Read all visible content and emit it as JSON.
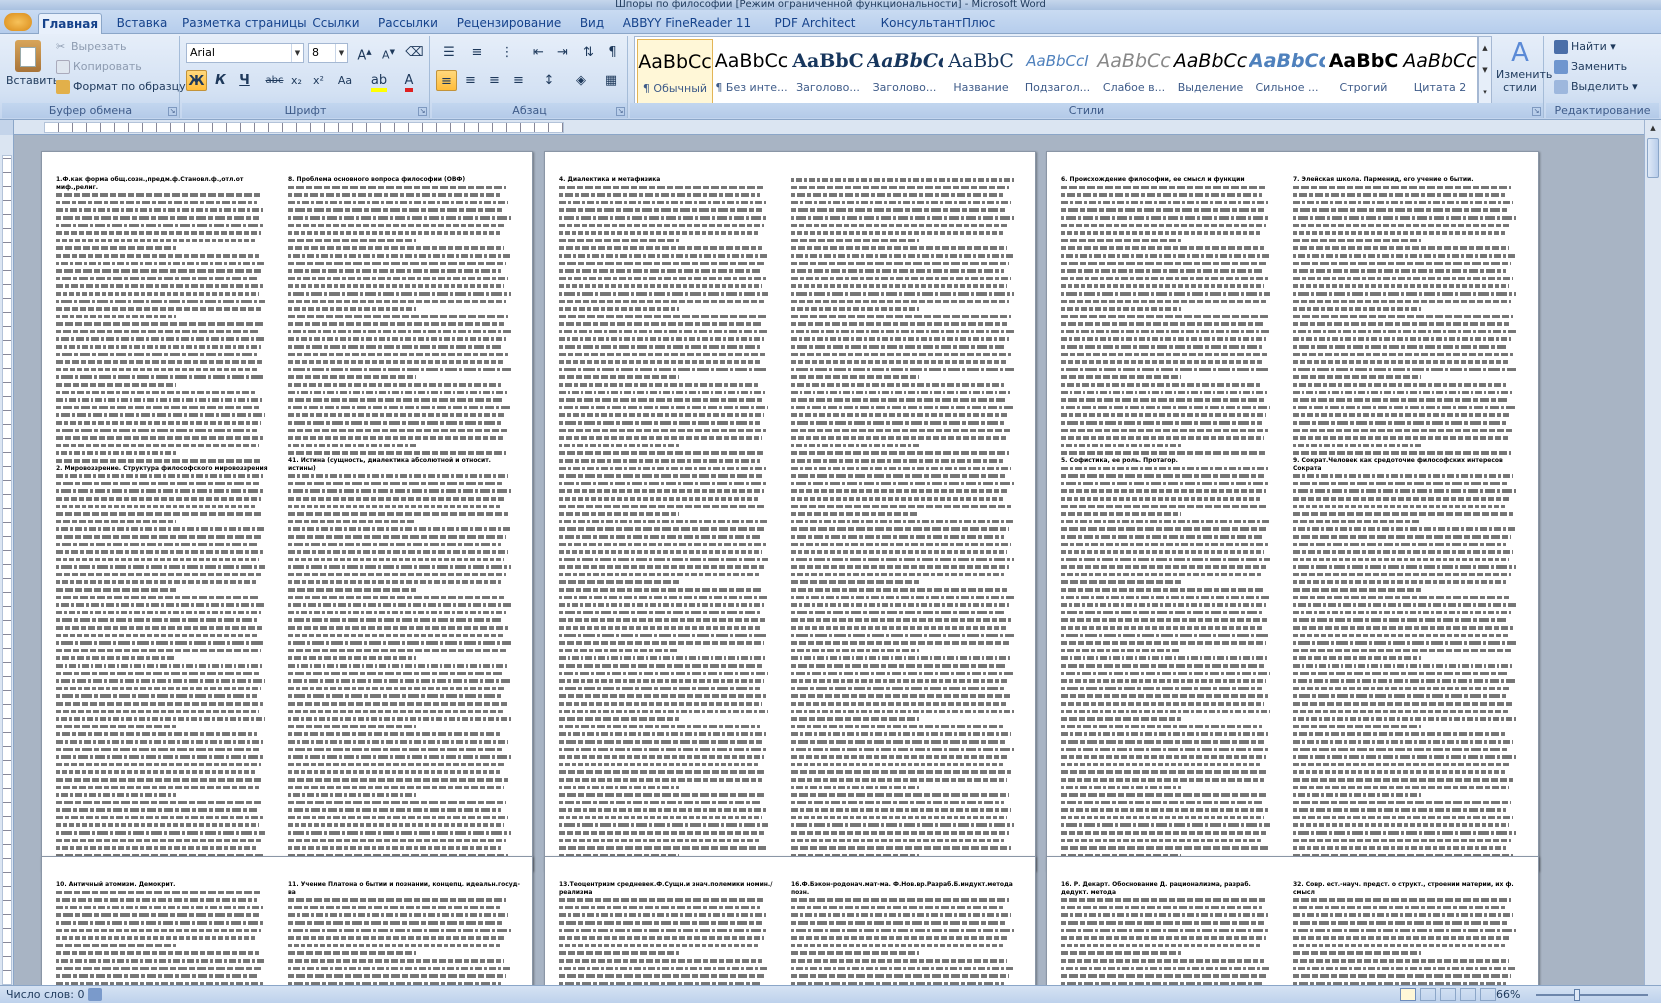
{
  "title": "Шпоры по философии [Режим ограниченной функциональности] - Microsoft Word",
  "tabs": [
    "Главная",
    "Вставка",
    "Разметка страницы",
    "Ссылки",
    "Рассылки",
    "Рецензирование",
    "Вид",
    "ABBYY FineReader 11",
    "PDF Architect",
    "КонсультантПлюс"
  ],
  "clipboard": {
    "paste": "Вставить",
    "cut": "Вырезать",
    "copy": "Копировать",
    "format_painter": "Формат по образцу",
    "label": "Буфер обмена"
  },
  "font": {
    "name": "Arial",
    "size": "8",
    "label": "Шрифт",
    "bold": "Ж",
    "italic": "К",
    "underline": "Ч",
    "strike": "abc",
    "sub": "x₂",
    "sup": "x²",
    "case": "Aa"
  },
  "paragraph": {
    "label": "Абзац"
  },
  "styles": {
    "label": "Стили",
    "items": [
      {
        "preview": "AaBbCc",
        "name": "¶ Обычный"
      },
      {
        "preview": "AaBbCc",
        "name": "¶ Без инте..."
      },
      {
        "preview": "AaBbC",
        "name": "Заголово..."
      },
      {
        "preview": "AaBbCc",
        "name": "Заголово..."
      },
      {
        "preview": "AaBbC",
        "name": "Название"
      },
      {
        "preview": "AaBbCcI",
        "name": "Подзагол..."
      },
      {
        "preview": "AaBbCc",
        "name": "Слабое в..."
      },
      {
        "preview": "AaBbCc",
        "name": "Выделение"
      },
      {
        "preview": "AaBbCc",
        "name": "Сильное ..."
      },
      {
        "preview": "AaBbC",
        "name": "Строгий"
      },
      {
        "preview": "AaBbCc",
        "name": "Цитата 2"
      }
    ],
    "change": "Изменить стили"
  },
  "editing": {
    "label": "Редактирование",
    "find": "Найти",
    "replace": "Заменить",
    "select": "Выделить"
  },
  "pages": [
    {
      "headings": [
        "1.Ф.как форма общ.созн.,предм.ф.Становл.ф.,отл.от миф.,религ.",
        "8. Проблема основного вопроса философии (ОВФ)",
        "2. Мировоззрение. Структура философского мировоззрения",
        "41. Истина (сущность, диалектика абсолютной и относит. истины)"
      ]
    },
    {
      "headings": [
        "4. Диалектика и метафизика",
        ""
      ]
    },
    {
      "headings": [
        "6. Происхождение философии, ее смысл и функции",
        "7. Элейская школа. Парменид, его учение о бытии.",
        "5. Софистика, ее роль. Протагор.",
        "9. Сократ.Человек как средоточие философских интересов Сократа"
      ]
    },
    {
      "headings": [
        "10. Античный атомизм. Демокрит.",
        "11. Учение Платона о бытии и познании, концепц. идеальн.госуд-ва"
      ]
    },
    {
      "headings": [
        "13.Теоцентризм средневек.Ф.Сущн.и знач.полемики номин./реализма",
        "16.Ф.Бэкон-родонач.мат-ма. Ф.Нов.вр.Разраб.Б.индукт.метода позн."
      ]
    },
    {
      "headings": [
        "16. Р. Декарт. Обоснование Д. рационализма, разраб. дедукт. метода",
        "32. Совр. ест.-науч. предст. о структ., строении материи, их ф. смысл"
      ]
    }
  ],
  "status": {
    "words": "Число слов: 0",
    "zoom": "66%"
  }
}
